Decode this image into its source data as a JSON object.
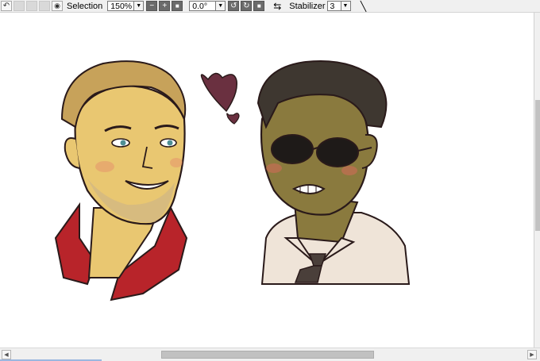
{
  "toolbar": {
    "buttons": [
      {
        "name": "undo-icon",
        "glyph": "↶",
        "state": "normal"
      },
      {
        "name": "redo-icon",
        "glyph": "↷",
        "state": "disabled"
      },
      {
        "name": "blank-1-icon",
        "glyph": "",
        "state": "disabled"
      },
      {
        "name": "blank-2-icon",
        "glyph": "",
        "state": "disabled"
      }
    ],
    "selection_label": "Selection",
    "zoom_value": "150%",
    "rotation_value": "0.0°",
    "stabilizer_label": "Stabilizer",
    "stabilizer_value": "3"
  },
  "colors": {
    "skin_left": "#e9c771",
    "skin_right": "#8a7a3e",
    "hair_left": "#c7a25a",
    "hair_right": "#3e3730",
    "jacket": "#b8242a",
    "shirt": "#efe4d8",
    "heart": "#6a3040"
  }
}
